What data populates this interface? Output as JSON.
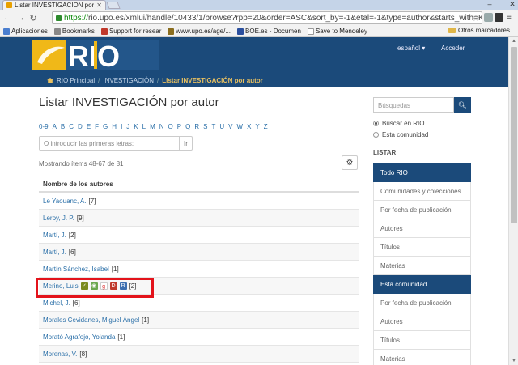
{
  "browser": {
    "tab_title": "Listar INVESTIGACIÓN por",
    "url_scheme": "https://",
    "url_rest": "rio.upo.es/xmlui/handle/10433/1/browse?rpp=20&order=ASC&sort_by=-1&etal=-1&type=author&starts_with=K",
    "bookmarks": [
      "Aplicaciones",
      "Bookmarks",
      "Support for resear",
      "www.upo.es/age/...",
      "BOE.es - Documen",
      "Save to Mendeley"
    ],
    "other_bookmarks": "Otros marcadores"
  },
  "header": {
    "logo_text": "RIO",
    "language": "español ▾",
    "login": "Acceder"
  },
  "breadcrumb": {
    "home": "RIO Principal",
    "parent": "INVESTIGACIÓN",
    "current": "Listar INVESTIGACIÓN por autor",
    "sep": "/"
  },
  "main": {
    "title": "Listar INVESTIGACIÓN por autor",
    "alphabet": [
      "0-9",
      "A",
      "B",
      "C",
      "D",
      "E",
      "F",
      "G",
      "H",
      "I",
      "J",
      "K",
      "L",
      "M",
      "N",
      "O",
      "P",
      "Q",
      "R",
      "S",
      "T",
      "U",
      "V",
      "W",
      "X",
      "Y",
      "Z"
    ],
    "starts_with_placeholder": "O introducir las primeras letras:",
    "starts_with_btn": "Ir",
    "showing": "Mostrando ítems 48-67 de 81",
    "column_header": "Nombre de los autores",
    "rows": [
      {
        "name": "Le Yaouanc, A.",
        "count": "[7]"
      },
      {
        "name": "Leroy, J. P.",
        "count": "[9]"
      },
      {
        "name": "Martí, J.",
        "count": "[2]"
      },
      {
        "name": "Martí, J.",
        "count": "[6]"
      },
      {
        "name": "Martín Sánchez, Isabel",
        "count": "[1]"
      },
      {
        "name": "Merino, Luis",
        "count": "[2]"
      },
      {
        "name": "Michel, J.",
        "count": "[6]"
      },
      {
        "name": "Morales Cevidanes, Miguel Ángel",
        "count": "[1]"
      },
      {
        "name": "Morató Agrafojo, Yolanda",
        "count": "[1]"
      },
      {
        "name": "Morenas, V.",
        "count": "[8]"
      }
    ]
  },
  "sidebar": {
    "search_placeholder": "Búsquedas",
    "search_scope_all": "Buscar en RIO",
    "search_scope_community": "Esta comunidad",
    "list_heading": "LISTAR",
    "items": [
      {
        "label": "Todo RIO",
        "active": true
      },
      {
        "label": "Comunidades y colecciones",
        "active": false
      },
      {
        "label": "Por fecha de publicación",
        "active": false
      },
      {
        "label": "Autores",
        "active": false
      },
      {
        "label": "Títulos",
        "active": false
      },
      {
        "label": "Materias",
        "active": false
      },
      {
        "label": "Esta comunidad",
        "active": true
      },
      {
        "label": "Por fecha de publicación",
        "active": false
      },
      {
        "label": "Autores",
        "active": false
      },
      {
        "label": "Títulos",
        "active": false
      },
      {
        "label": "Materias",
        "active": false
      }
    ]
  },
  "colors": {
    "brand": "#1b4a7a",
    "accent": "#e8c060",
    "link": "#2a6fa8",
    "highlight": "#e3131b"
  }
}
